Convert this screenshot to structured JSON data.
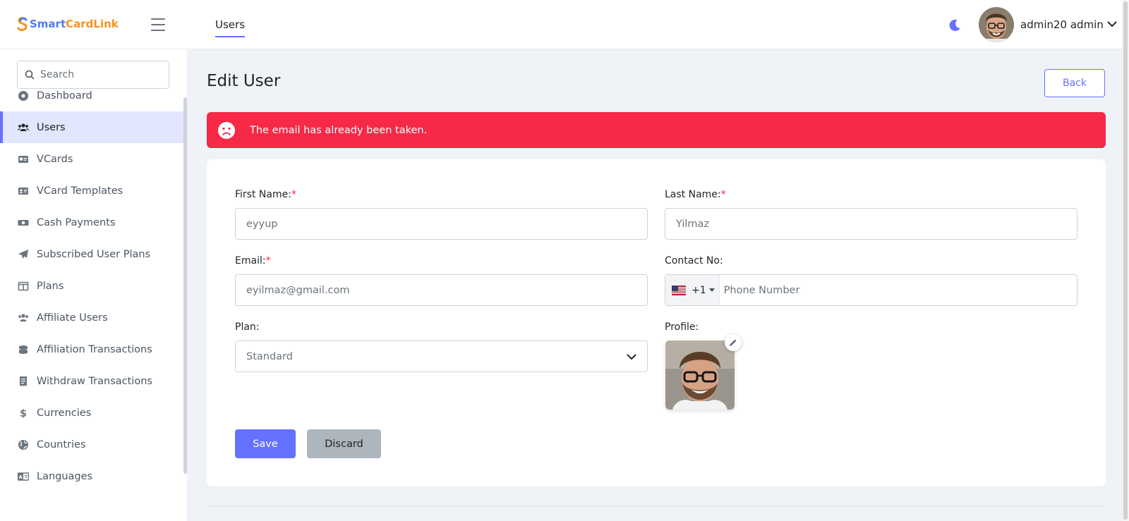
{
  "brand": {
    "name_part1": "Smart",
    "name_part2": "CardLink"
  },
  "header": {
    "active_tab": "Users",
    "user_name": "admin20 admin"
  },
  "sidebar": {
    "search_placeholder": "Search",
    "items": [
      {
        "label": "Dashboard",
        "icon": "dashboard-icon"
      },
      {
        "label": "Users",
        "icon": "users-icon",
        "active": true
      },
      {
        "label": "VCards",
        "icon": "vcard-icon"
      },
      {
        "label": "VCard Templates",
        "icon": "id-card-icon"
      },
      {
        "label": "Cash Payments",
        "icon": "money-icon"
      },
      {
        "label": "Subscribed User Plans",
        "icon": "paper-plane-icon"
      },
      {
        "label": "Plans",
        "icon": "columns-icon"
      },
      {
        "label": "Affiliate Users",
        "icon": "users-icon"
      },
      {
        "label": "Affiliation Transactions",
        "icon": "coins-icon"
      },
      {
        "label": "Withdraw Transactions",
        "icon": "receipt-icon"
      },
      {
        "label": "Currencies",
        "icon": "dollar-icon"
      },
      {
        "label": "Countries",
        "icon": "globe-icon"
      },
      {
        "label": "Languages",
        "icon": "language-icon"
      }
    ]
  },
  "page": {
    "title": "Edit User",
    "back_label": "Back",
    "alert": "The email has already been taken."
  },
  "form": {
    "first_name": {
      "label": "First Name:",
      "required": "*",
      "value": "eyyup"
    },
    "last_name": {
      "label": "Last Name:",
      "required": "*",
      "value": "Yilmaz"
    },
    "email": {
      "label": "Email:",
      "required": "*",
      "value": "eyilmaz@gmail.com"
    },
    "contact": {
      "label": "Contact No:",
      "dial_code": "+1",
      "placeholder": "Phone Number"
    },
    "plan": {
      "label": "Plan:",
      "value": "Standard"
    },
    "profile": {
      "label": "Profile:"
    },
    "save_label": "Save",
    "discard_label": "Discard"
  },
  "colors": {
    "accent": "#6571ff",
    "danger": "#f62947",
    "background": "#eff3f7"
  }
}
